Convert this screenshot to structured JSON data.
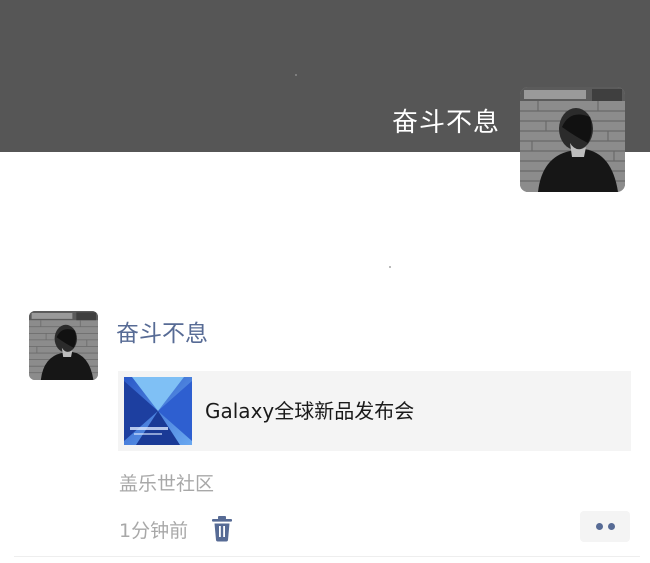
{
  "profile": {
    "name": "奋斗不息",
    "avatar_icon": "person-avatar"
  },
  "moment": {
    "poster_name": "奋斗不息",
    "link": {
      "title": "Galaxy全球新品发布会",
      "thumbnail_icon": "samsung-galaxy-event-thumbnail"
    },
    "source": "盖乐世社区",
    "time": "1分钟前",
    "delete_icon": "trash-icon",
    "more_icon": "more-dots-icon"
  },
  "colors": {
    "cover_bg": "#565656",
    "name_link": "#576b95",
    "meta_text": "#a8a8a8",
    "card_bg": "#f4f4f4"
  }
}
